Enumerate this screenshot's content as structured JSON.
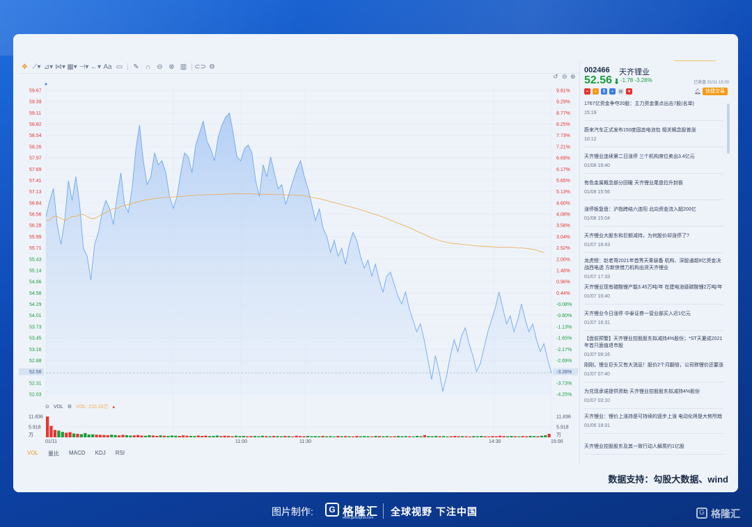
{
  "stock": {
    "code": "002466",
    "name": "天齐锂业",
    "price": "52.56",
    "change": "-1.78 -3.28%",
    "status": "已收盘 01/11 15:00",
    "trade_button": "快捷交易"
  },
  "chart_data": {
    "type": "line",
    "price_ticks": [
      "59.67",
      "59.39",
      "59.11",
      "58.82",
      "58.54",
      "58.26",
      "57.97",
      "57.69",
      "57.41",
      "57.13",
      "56.84",
      "56.56",
      "56.28",
      "55.99",
      "55.71",
      "55.43",
      "55.14",
      "54.86",
      "54.58",
      "54.29",
      "54.01",
      "53.73",
      "53.45",
      "53.16",
      "52.88",
      "52.56",
      "52.31",
      "52.03"
    ],
    "pct_ticks": [
      "9.81%",
      "9.29%",
      "8.77%",
      "8.25%",
      "7.73%",
      "7.21%",
      "6.69%",
      "6.17%",
      "5.65%",
      "5.13%",
      "4.60%",
      "4.08%",
      "3.56%",
      "3.04%",
      "2.52%",
      "2.00%",
      "1.48%",
      "0.96%",
      "0.44%",
      "-0.08%",
      "-0.60%",
      "-1.13%",
      "-1.65%",
      "-2.17%",
      "-2.69%",
      "-3.28%",
      "-3.73%",
      "-4.25%"
    ],
    "ylim": [
      52.03,
      59.67
    ],
    "current_price_label": "52.56",
    "current_pct_label": "-3.28%",
    "time_labels": [
      "01/11",
      "11:00",
      "11:30",
      "14:30",
      "15:00"
    ],
    "price": [
      56.5,
      56.9,
      57.2,
      56.3,
      55.8,
      56.4,
      57.4,
      56.9,
      57.5,
      56.8,
      55.7,
      55.5,
      54.9,
      55.8,
      56.1,
      56.6,
      56.9,
      56.7,
      56.3,
      57.0,
      57.6,
      56.8,
      56.6,
      57.2,
      58.2,
      58.8,
      57.9,
      57.3,
      57.5,
      58.1,
      57.8,
      57.9,
      57.6,
      57.0,
      56.7,
      57.0,
      57.6,
      58.1,
      58.0,
      57.6,
      58.3,
      58.6,
      58.9,
      58.4,
      58.2,
      57.9,
      58.5,
      58.8,
      59.0,
      59.1,
      58.6,
      58.0,
      57.9,
      58.2,
      58.3,
      58.1,
      57.4,
      57.0,
      57.8,
      57.5,
      58.0,
      57.6,
      57.2,
      57.3,
      56.8,
      57.1,
      57.4,
      57.7,
      57.9,
      57.5,
      57.2,
      56.8,
      56.4,
      56.7,
      56.2,
      56.0,
      55.6,
      55.9,
      55.5,
      55.7,
      55.3,
      55.8,
      56.1,
      55.9,
      55.5,
      55.2,
      55.4,
      55.0,
      55.3,
      54.9,
      54.6,
      55.0,
      55.1,
      54.8,
      54.5,
      54.3,
      54.6,
      54.2,
      53.9,
      53.6,
      53.8,
      53.4,
      52.9,
      52.4,
      53.0,
      52.6,
      52.1,
      52.5,
      53.0,
      53.4,
      53.1,
      53.5,
      53.7,
      53.3,
      53.0,
      52.6,
      52.8,
      53.2,
      53.6,
      53.9,
      54.2,
      54.6,
      54.2,
      53.8,
      54.0,
      53.6,
      53.9,
      54.3,
      53.9,
      53.6,
      53.8,
      53.4,
      53.1,
      53.3,
      52.9,
      52.56
    ],
    "avg_price": [
      56.4,
      56.4,
      56.5,
      56.5,
      56.45,
      56.4,
      56.45,
      56.5,
      56.5,
      56.55,
      56.55,
      56.5,
      56.45,
      56.45,
      56.5,
      56.55,
      56.6,
      56.65,
      56.7,
      56.7,
      56.75,
      56.78,
      56.8,
      56.82,
      56.85,
      56.88,
      56.9,
      56.92,
      56.93,
      56.95,
      56.96,
      56.97,
      56.98,
      56.98,
      56.99,
      57.0,
      57.0,
      57.01,
      57.02,
      57.02,
      57.03,
      57.04,
      57.04,
      57.05,
      57.05,
      57.05,
      57.06,
      57.06,
      57.06,
      57.07,
      57.07,
      57.07,
      57.07,
      57.07,
      57.07,
      57.07,
      57.06,
      57.06,
      57.06,
      57.06,
      57.06,
      57.05,
      57.05,
      57.05,
      57.04,
      57.04,
      57.04,
      57.03,
      57.03,
      57.02,
      57.0,
      56.98,
      56.96,
      56.95,
      56.92,
      56.9,
      56.87,
      56.85,
      56.82,
      56.8,
      56.77,
      56.75,
      56.72,
      56.7,
      56.67,
      56.64,
      56.61,
      56.58,
      56.55,
      56.52,
      56.48,
      56.45,
      56.41,
      56.37,
      56.33,
      56.3,
      56.26,
      56.22,
      56.18,
      56.13,
      56.09,
      56.05,
      56.0,
      55.96,
      55.93,
      55.9,
      55.87,
      55.85,
      55.83,
      55.82,
      55.81,
      55.8,
      55.79,
      55.78,
      55.77,
      55.76,
      55.75,
      55.75,
      55.74,
      55.74,
      55.73,
      55.73,
      55.73,
      55.72,
      55.72,
      55.72,
      55.71,
      55.71,
      55.7,
      55.69,
      55.67,
      55.65,
      55.62,
      55.6
    ],
    "volume_ticks": [
      "11.836",
      "5.918",
      "万"
    ],
    "volume": [
      11.8,
      6.5,
      4.2,
      3.8,
      3.1,
      2.6,
      2.9,
      2.2,
      2.0,
      1.8,
      2.4,
      1.6,
      1.7,
      1.5,
      1.4,
      1.3,
      1.2,
      1.5,
      1.3,
      1.1,
      1.4,
      1.2,
      1.0,
      1.1,
      1.3,
      1.0,
      0.9,
      1.2,
      1.0,
      0.8,
      1.1,
      0.9,
      0.8,
      1.0,
      0.9,
      0.8,
      1.1,
      0.9,
      0.8,
      0.7,
      1.0,
      0.8,
      0.9,
      0.7,
      0.8,
      1.0,
      0.7,
      0.9,
      0.8,
      0.6,
      0.9,
      0.7,
      0.8,
      0.6,
      0.7,
      0.8,
      0.6,
      0.9,
      0.7,
      0.6,
      0.8,
      0.7,
      0.6,
      0.8,
      0.7,
      0.5,
      0.9,
      0.7,
      0.6,
      0.8,
      0.6,
      0.7,
      0.6,
      0.8,
      0.6,
      0.7,
      0.5,
      0.8,
      0.6,
      0.7,
      0.6,
      0.5,
      0.8,
      0.6,
      0.7,
      0.6,
      0.5,
      0.8,
      0.7,
      0.6,
      0.7,
      0.5,
      0.6,
      0.8,
      0.6,
      0.7,
      0.6,
      0.5,
      0.8,
      0.6,
      1.2,
      0.7,
      0.6,
      0.8,
      0.6,
      0.7,
      0.5,
      0.6,
      0.8,
      0.6,
      0.7,
      0.6,
      0.5,
      0.7,
      0.6,
      0.8,
      0.6,
      0.5,
      0.7,
      0.6,
      0.9,
      0.7,
      0.6,
      0.8,
      0.6,
      0.5,
      0.7,
      0.6,
      0.8,
      0.7,
      0.6,
      0.9,
      1.2,
      2.0
    ]
  },
  "vol_legend": {
    "label": "VOL",
    "value": "VOL: 210.10万"
  },
  "indicator_tabs": [
    "VOL",
    "量比",
    "MACD",
    "KDJ",
    "RSI"
  ],
  "news": [
    {
      "title": "1767亿资金争夺20股：主力资金重点出击7股(名单)",
      "time": "15:19"
    },
    {
      "title": "蔚来汽车正式发布150度固态电池包 相关概念股普涨",
      "time": "10:12"
    },
    {
      "title": "天齐锂业连续第二日涨停 三个机构席位卖出3.4亿元",
      "time": "01/08 16:40"
    },
    {
      "title": "有色金属概念部分回暖 天齐锂业尾盘拉升封板",
      "time": "01/08 15:56"
    },
    {
      "title": "涨停板复盘：沪指跨结六连阳 北向资金流入超200亿",
      "time": "01/08 15:04"
    },
    {
      "title": "天齐锂业大股东和巨额减持，为何股价却涨停了?",
      "time": "01/07 18:43"
    },
    {
      "title": "龙虎榜：赵老哥2021年首秀天秦装备 机构、深股通超8亿资金决战西电透 方新侠借力机构出货天齐锂业",
      "time": "01/07 17:33"
    },
    {
      "title": "天齐锂业现有碳酸锂产能3.45万吨/年 在建电池级碳酸锂2万吨/年",
      "time": "01/07 16:40"
    },
    {
      "title": "天齐锂业今日涨停 中泰证券一营业部买入近1亿元",
      "time": "01/07 16:31"
    },
    {
      "title": "【盘前预警】天齐锂业控股股东拟减持4%股份；*ST天夏成2021年首只面值退市股",
      "time": "01/07 09:16"
    },
    {
      "title": "刚刚，锂业巨头又有大消息！股价2个月翻倍，公司称锂价还要涨",
      "time": "01/07 07:40"
    },
    {
      "title": "为兑现承诺提供资助 天齐锂业控股股东拟减持4%股份",
      "time": "01/07 03:10"
    },
    {
      "title": "天齐锂业：锂价上涨持是可持续的逐步上涨 电动化将是大势所趋",
      "time": "01/06 18:31"
    },
    {
      "title": "天齐锂业控股股东及其一致行动人解质约1亿股",
      "time": ""
    }
  ],
  "source_text": "数据支持：勾股大数据、wind",
  "footer": {
    "made_by": "图片制作:",
    "logo_text": "格隆汇",
    "logo_url": "www.gelonghui.com",
    "slogan": "全球视野 下注中国",
    "corner_logo": "格隆汇"
  },
  "colors": {
    "up": "#e8332e",
    "down": "#1a9d3a",
    "price_line": "#6fa8f0",
    "avg_line": "#f0a94a",
    "accent": "#f49a16"
  }
}
